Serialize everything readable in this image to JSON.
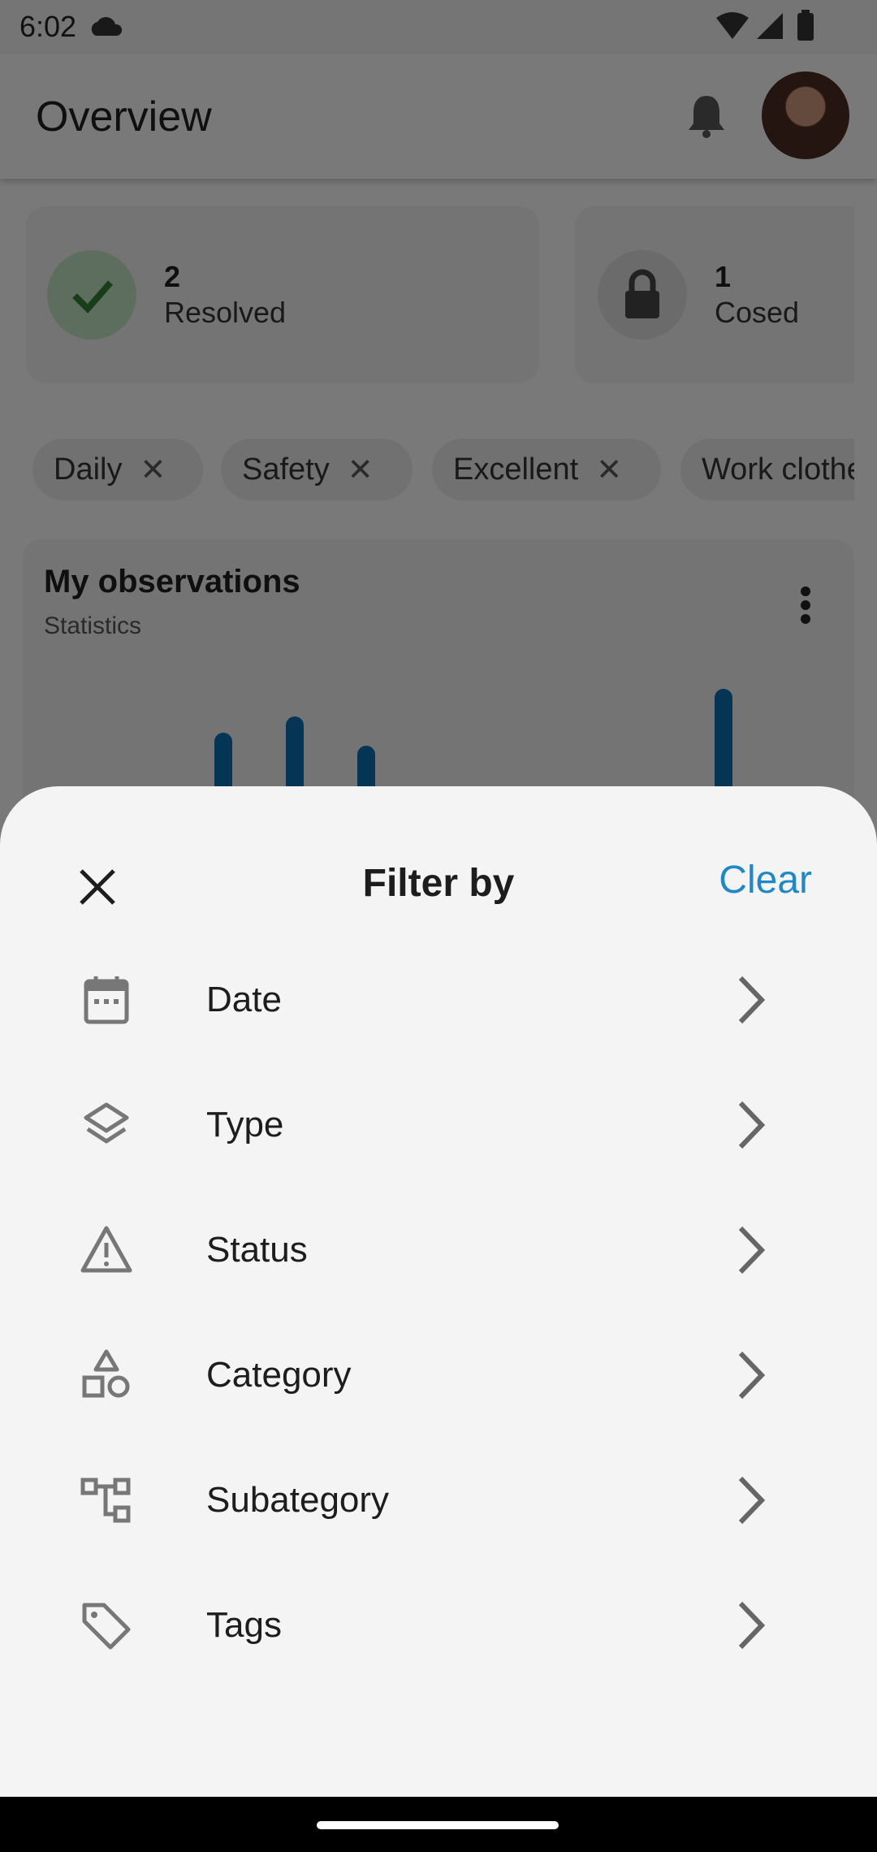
{
  "status_bar": {
    "time": "6:02"
  },
  "app_bar": {
    "title": "Overview"
  },
  "stats": [
    {
      "count": "2",
      "label": "Resolved"
    },
    {
      "count": "1",
      "label": "Cosed"
    }
  ],
  "chips": [
    "Daily",
    "Safety",
    "Excellent",
    "Work clothe"
  ],
  "observations": {
    "title": "My observations",
    "subtitle": "Statistics"
  },
  "sheet": {
    "title": "Filter by",
    "clear_label": "Clear",
    "items": [
      {
        "label": "Date",
        "icon": "calendar-icon"
      },
      {
        "label": "Type",
        "icon": "layers-icon"
      },
      {
        "label": "Status",
        "icon": "warning-icon"
      },
      {
        "label": "Category",
        "icon": "shapes-icon"
      },
      {
        "label": "Subategory",
        "icon": "hierarchy-icon"
      },
      {
        "label": "Tags",
        "icon": "tag-icon"
      }
    ]
  },
  "colors": {
    "accent": "#1e88c8",
    "bar": "#0a6ba8",
    "resolved": "#2e7d32"
  }
}
